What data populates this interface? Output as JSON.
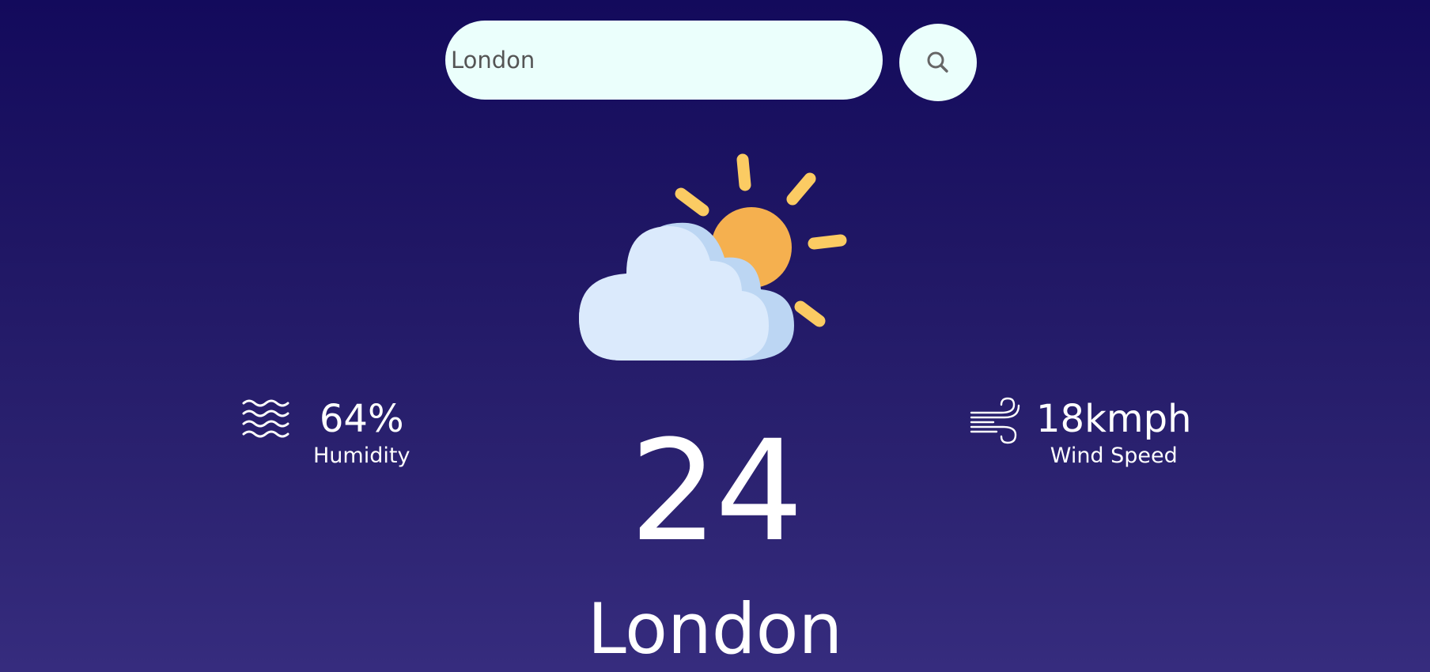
{
  "search": {
    "value": "London",
    "button_icon": "search-icon"
  },
  "weather": {
    "icon": "partly-cloudy-icon",
    "temperature": "24",
    "city": "London"
  },
  "humidity": {
    "icon": "humidity-waves-icon",
    "value": "64%",
    "label": "Humidity"
  },
  "wind": {
    "icon": "wind-icon",
    "value": "18kmph",
    "label": "Wind Speed"
  },
  "colors": {
    "background_top": "#130a5c",
    "background_bottom": "#362c7e",
    "search_bg": "#ebfffc",
    "sun": "#f5b04f",
    "sun_rays": "#fbcb63",
    "cloud": "#dbeafc",
    "cloud_shade": "#bcd6f3"
  }
}
